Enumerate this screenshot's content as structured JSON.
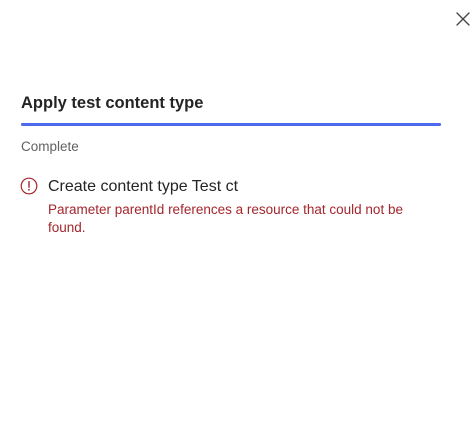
{
  "panel": {
    "title": "Apply test content type",
    "close_icon": "close-icon",
    "progress": {
      "value": 1.0,
      "color": "#4f6bed"
    },
    "status": "Complete"
  },
  "results": [
    {
      "icon": "error-circle-icon",
      "title": "Create content type Test ct",
      "message": "Parameter parentId references a resource that could not be found.",
      "message_color": "#a4262c"
    }
  ]
}
